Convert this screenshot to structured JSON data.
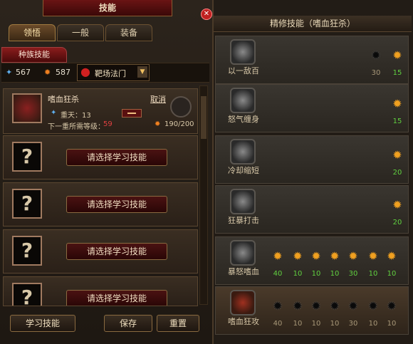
{
  "window_title": "技能",
  "tabs": [
    "领悟",
    "一般",
    "装备"
  ],
  "race_tab": "种族技能",
  "resources": {
    "blue_value": "567",
    "orange_value": "587",
    "school": "靶场法门"
  },
  "current_skill": {
    "name": "嗜血狂杀",
    "cancel": "取消",
    "level_line": "重天：13",
    "req_label": "下一重所需等级：",
    "req_value": "59",
    "progress": "190/200"
  },
  "slots": [
    {
      "button": "请选择学习技能"
    },
    {
      "button": "请选择学习技能"
    },
    {
      "button": "请选择学习技能"
    },
    {
      "button": "请选择学习技能"
    }
  ],
  "bottom_buttons": {
    "learn": "学习技能",
    "save": "保存",
    "reset": "重置"
  },
  "right_panel": {
    "title": "精修技能（嗜血狂杀）",
    "rows": [
      {
        "label": "以一敌百",
        "nodes": [
          {
            "state": "off",
            "num": "30"
          },
          {
            "state": "on",
            "num": "15"
          }
        ]
      },
      {
        "label": "怒气缠身",
        "nodes": [
          {
            "state": "on",
            "num": "15"
          }
        ]
      },
      {
        "label": "冷却缩短",
        "nodes": [
          {
            "state": "on",
            "num": "20"
          }
        ]
      },
      {
        "label": "狂暴打击",
        "nodes": [
          {
            "state": "on",
            "num": "20"
          }
        ]
      },
      {
        "label": "暴怒嗜血",
        "nodes": [
          {
            "state": "on",
            "num": "40"
          },
          {
            "state": "on",
            "num": "10"
          },
          {
            "state": "on",
            "num": "10"
          },
          {
            "state": "on",
            "num": "10"
          },
          {
            "state": "on",
            "num": "30"
          },
          {
            "state": "on",
            "num": "10"
          },
          {
            "state": "on",
            "num": "10"
          }
        ]
      },
      {
        "label": "嗜血狂攻",
        "nodes": [
          {
            "state": "off",
            "num": "40"
          },
          {
            "state": "off",
            "num": "10"
          },
          {
            "state": "off",
            "num": "10"
          },
          {
            "state": "off",
            "num": "10"
          },
          {
            "state": "off",
            "num": "30"
          },
          {
            "state": "off",
            "num": "10"
          },
          {
            "state": "off",
            "num": "10"
          }
        ]
      }
    ]
  },
  "colors": {
    "accent_red": "#8a1c1c",
    "gold": "#f0a020",
    "green_num": "#60d040"
  }
}
